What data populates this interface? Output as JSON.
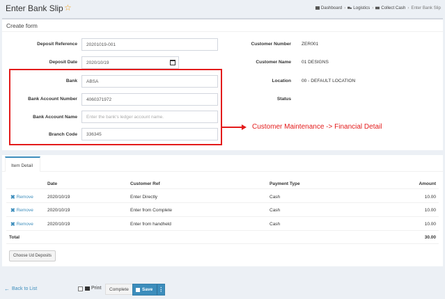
{
  "header": {
    "title": "Enter Bank Slip",
    "breadcrumb": [
      "Dashboard",
      "Logistics",
      "Collect Cash",
      "Enter Bank Slip"
    ]
  },
  "form": {
    "box_title": "Create form",
    "deposit_reference": {
      "label": "Deposit Reference",
      "value": "20201019-001"
    },
    "deposit_date": {
      "label": "Deposit Date",
      "value": "2020/10/19"
    },
    "bank": {
      "label": "Bank",
      "value": "ABSA"
    },
    "bank_account_number": {
      "label": "Bank Account Number",
      "value": "4060371972"
    },
    "bank_account_name": {
      "label": "Bank Account Name",
      "value": "",
      "placeholder": "Enter the bank's ledger account name."
    },
    "branch_code": {
      "label": "Branch Code",
      "value": "336345"
    },
    "customer_number": {
      "label": "Customer Number",
      "value": "ZER001"
    },
    "customer_name": {
      "label": "Customer Name",
      "value": "01 DESIGNS"
    },
    "location": {
      "label": "Location",
      "value": "00 - DEFAULT LOCATION"
    },
    "status": {
      "label": "Status",
      "value": ""
    }
  },
  "annotation": {
    "text": "Customer Maintenance -> Financial Detail",
    "color": "#e31b1b"
  },
  "items": {
    "tab_label": "Item Detail",
    "columns": {
      "date": "Date",
      "customer_ref": "Customer Ref",
      "payment_type": "Payment Type",
      "amount": "Amount"
    },
    "remove_label": "Remove",
    "rows": [
      {
        "date": "2020/10/19",
        "customer_ref": "Enter Directly",
        "payment_type": "Cash",
        "amount": "10.00"
      },
      {
        "date": "2020/10/19",
        "customer_ref": "Enter from Complete",
        "payment_type": "Cash",
        "amount": "10.00"
      },
      {
        "date": "2020/10/19",
        "customer_ref": "Enter from handheld",
        "payment_type": "Cash",
        "amount": "10.00"
      }
    ],
    "total_label": "Total",
    "total_value": "30.00",
    "choose_button": "Choose Ud Deposits"
  },
  "footer": {
    "back_label": "Back to List",
    "print_label": "Print",
    "complete_label": "Complete",
    "save_label": "Save"
  },
  "colors": {
    "accent": "#3c8dbc",
    "star": "#f39c12",
    "annotation": "#e31b1b"
  }
}
